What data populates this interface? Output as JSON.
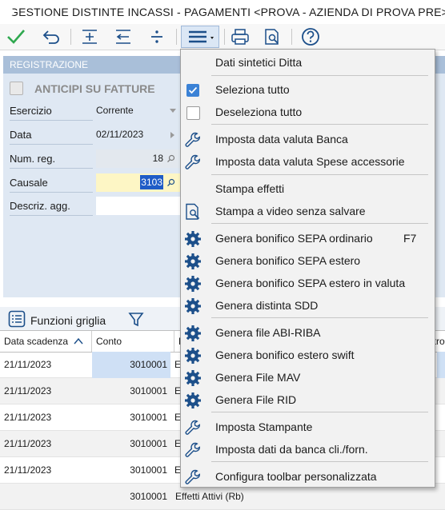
{
  "window": {
    "title": "GESTIONE DISTINTE INCASSI - PAGAMENTI <PROVA - AZIENDA DI PROVA PRE>"
  },
  "panel": {
    "header": "REGISTRAZIONE",
    "anticipi_label": "ANTICIPI SU FATTURE",
    "fields": {
      "esercizio_label": "Esercizio",
      "esercizio_value": "Corrente",
      "data_label": "Data",
      "data_value": "02/11/2023",
      "numreg_label": "Num. reg.",
      "numreg_value": "18",
      "causale_label": "Causale",
      "causale_value": "3103",
      "descriz_label": "Descriz. agg.",
      "descriz_value": ""
    }
  },
  "grid_bar": {
    "label": "Funzioni griglia"
  },
  "grid": {
    "headers": [
      "Data scadenza",
      "Conto",
      "D",
      "ntro"
    ],
    "rows": [
      {
        "date": "21/11/2023",
        "conto": "3010001",
        "d": "E"
      },
      {
        "date": "21/11/2023",
        "conto": "3010001",
        "d": "E"
      },
      {
        "date": "21/11/2023",
        "conto": "3010001",
        "d": "E"
      },
      {
        "date": "21/11/2023",
        "conto": "3010001",
        "d": "E"
      },
      {
        "date": "21/11/2023",
        "conto": "3010001",
        "d": "E"
      },
      {
        "date": "",
        "conto": "3010001",
        "d": "Effetti Attivi (Rb)"
      }
    ]
  },
  "menu": {
    "items": [
      {
        "label": "Dati sintetici Ditta",
        "icon": "none"
      },
      {
        "label": "Seleziona tutto",
        "icon": "checkbox-checked-icon"
      },
      {
        "label": "Deseleziona tutto",
        "icon": "checkbox-empty-icon"
      },
      {
        "label": "Imposta data valuta Banca",
        "icon": "wrench-icon"
      },
      {
        "label": "Imposta data valuta Spese accessorie",
        "icon": "wrench-icon"
      },
      {
        "label": "Stampa effetti",
        "icon": "none"
      },
      {
        "label": "Stampa a video senza salvare",
        "icon": "print-preview-icon"
      },
      {
        "label": "Genera bonifico SEPA ordinario",
        "shortcut": "F7",
        "icon": "gear-icon"
      },
      {
        "label": "Genera bonifico SEPA estero",
        "icon": "gear-icon"
      },
      {
        "label": "Genera bonifico SEPA estero in valuta",
        "icon": "gear-icon"
      },
      {
        "label": "Genera distinta SDD",
        "icon": "gear-icon"
      },
      {
        "label": "Genera file ABI-RIBA",
        "icon": "gear-icon"
      },
      {
        "label": "Genera bonifico estero swift",
        "icon": "gear-icon"
      },
      {
        "label": "Genera File MAV",
        "icon": "gear-icon"
      },
      {
        "label": "Genera File RID",
        "icon": "gear-icon"
      },
      {
        "label": "Imposta Stampante",
        "icon": "wrench-icon"
      },
      {
        "label": "Imposta dati da banca cli./forn.",
        "icon": "wrench-icon"
      },
      {
        "label": "Configura toolbar personalizzata",
        "icon": "wrench-icon"
      }
    ]
  },
  "colors": {
    "accent_blue": "#1f5cc7",
    "toolbar_icon_blue": "#1c4f8a",
    "confirm_green": "#2fa84f",
    "panel_bg": "#dfe8f3",
    "panel_header": "#a9bfd9",
    "menu_bg": "#f2f2f2"
  }
}
